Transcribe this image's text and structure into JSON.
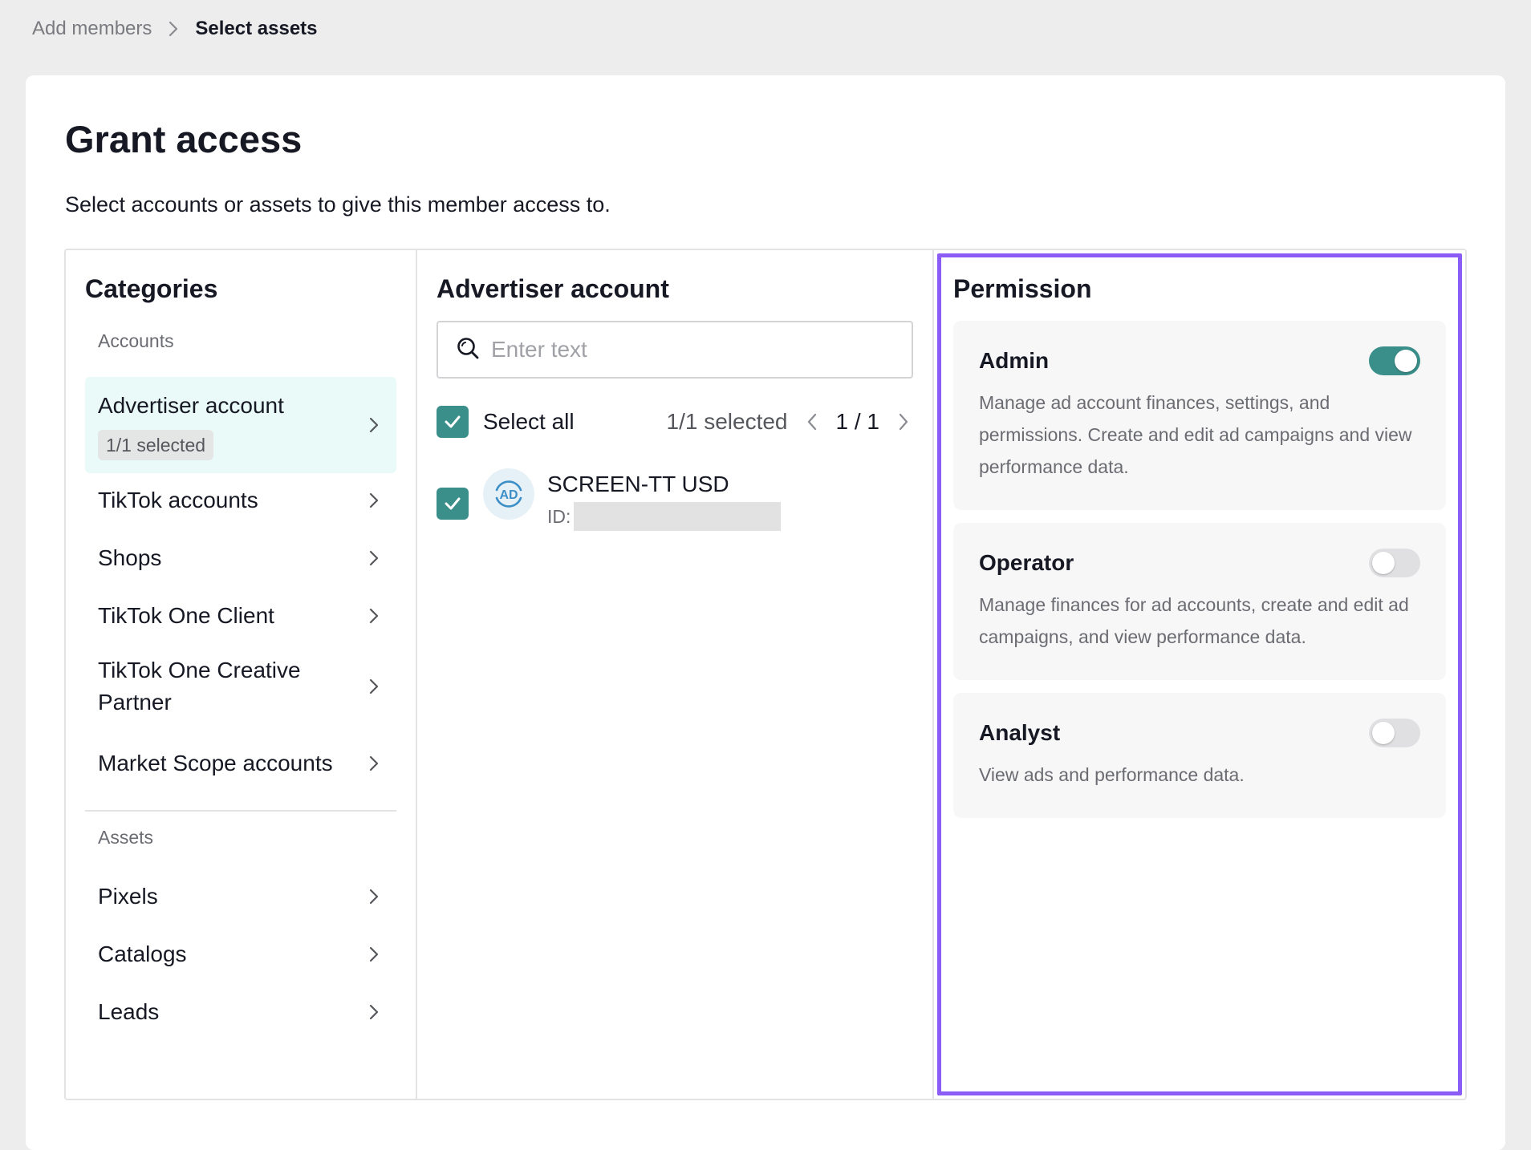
{
  "breadcrumb": {
    "previous": "Add members",
    "current": "Select assets"
  },
  "page": {
    "title": "Grant access",
    "subtitle": "Select accounts or assets to give this member access to."
  },
  "categories": {
    "title": "Categories",
    "accounts_label": "Accounts",
    "accounts": [
      {
        "label": "Advertiser account",
        "badge": "1/1 selected",
        "selected": true
      },
      {
        "label": "TikTok accounts"
      },
      {
        "label": "Shops"
      },
      {
        "label": "TikTok One Client"
      },
      {
        "label": "TikTok One Creative Partner"
      },
      {
        "label": "Market Scope accounts"
      }
    ],
    "assets_label": "Assets",
    "assets": [
      {
        "label": "Pixels"
      },
      {
        "label": "Catalogs"
      },
      {
        "label": "Leads"
      }
    ]
  },
  "advertiser": {
    "title": "Advertiser account",
    "search_placeholder": "Enter text",
    "select_all_label": "Select all",
    "selected_count": "1/1 selected",
    "page_indicator": "1 / 1",
    "items": [
      {
        "avatar_text": "AD",
        "name": "SCREEN-TT USD",
        "id_label": "ID:",
        "checked": true
      }
    ]
  },
  "permission": {
    "title": "Permission",
    "roles": [
      {
        "name": "Admin",
        "description": "Manage ad account finances, settings, and permissions. Create and edit ad campaigns and view performance data.",
        "enabled": true
      },
      {
        "name": "Operator",
        "description": "Manage finances for ad accounts, create and edit ad campaigns, and view performance data.",
        "enabled": false
      },
      {
        "name": "Analyst",
        "description": "View ads and performance data.",
        "enabled": false
      }
    ]
  },
  "colors": {
    "accent": "#3a8f8a",
    "highlight": "#8b5cf6",
    "selected_bg": "#eafaf9"
  }
}
